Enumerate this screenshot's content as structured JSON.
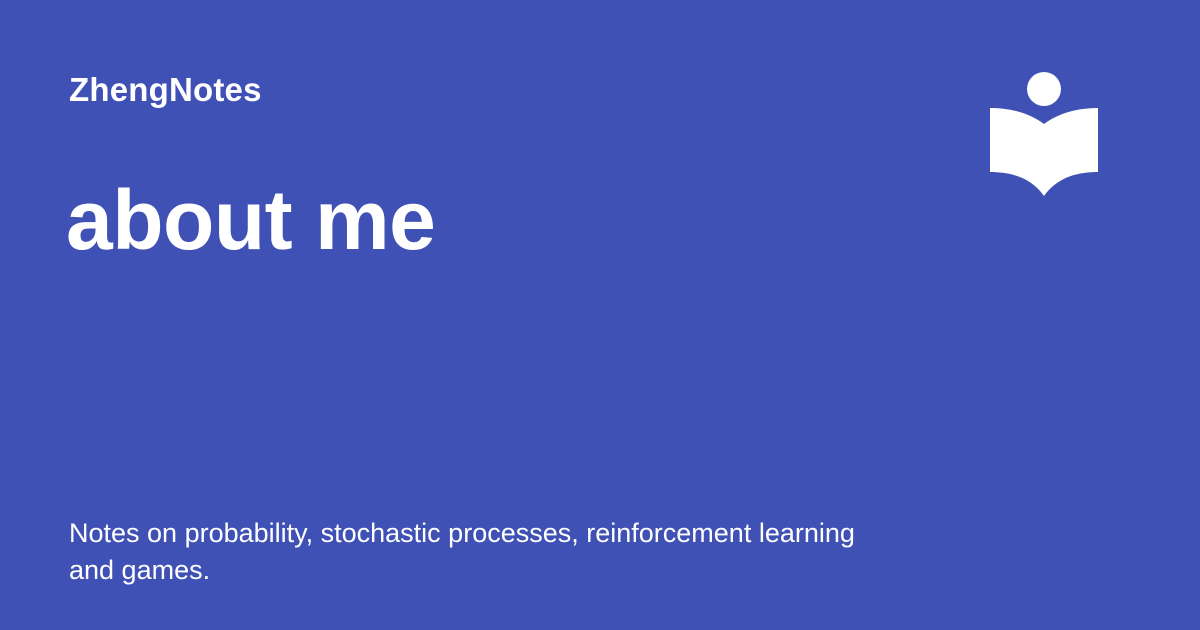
{
  "site": {
    "name": "ZhengNotes"
  },
  "page": {
    "title": "about me",
    "description": "Notes on probability, stochastic processes, reinforcement learning and games."
  },
  "logo": {
    "icon": "reader-book-icon"
  },
  "colors": {
    "background": "#3f51b5",
    "text": "#ffffff"
  }
}
